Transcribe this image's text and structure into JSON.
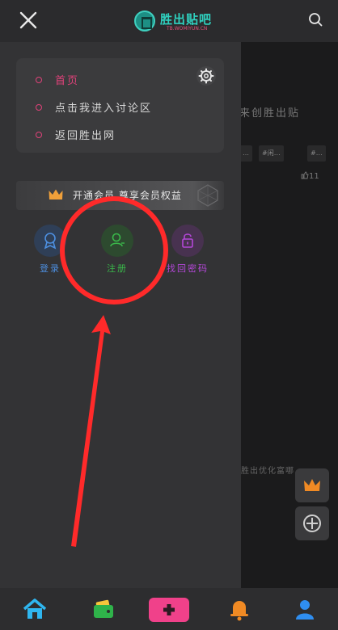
{
  "header": {
    "close_icon": "close-icon",
    "logo_title": "胜出贴吧",
    "logo_sub": "TB.WOMIYUN.CN",
    "search_icon": "search-icon"
  },
  "drawer": {
    "menu": [
      {
        "label": "首页",
        "active": true
      },
      {
        "label": "点击我进入讨论区",
        "active": false
      },
      {
        "label": "返回胜出网",
        "active": false
      }
    ],
    "settings_icon": "gear-icon",
    "vip_banner": "开通会员 尊享会员权益",
    "actions": [
      {
        "label": "登录",
        "icon": "badge-icon",
        "color": "#4d8fe0"
      },
      {
        "label": "注册",
        "icon": "user-icon",
        "color": "#3ab84a"
      },
      {
        "label": "找回密码",
        "icon": "lock-icon",
        "color": "#b447d8"
      }
    ]
  },
  "background_page": {
    "text_1": "来创胜出贴",
    "tags": [
      "…",
      "#闲…",
      "#…"
    ],
    "like_count": "11",
    "text_2": "胜出优化富哪…"
  },
  "bottom_nav": {
    "items": [
      "home-icon",
      "wallet-icon",
      "add-post-icon",
      "bell-icon",
      "user-icon"
    ]
  },
  "colors": {
    "accent_pink": "#e0427a",
    "teal": "#2fd1bf",
    "annotation_red": "#ff2a2a"
  }
}
